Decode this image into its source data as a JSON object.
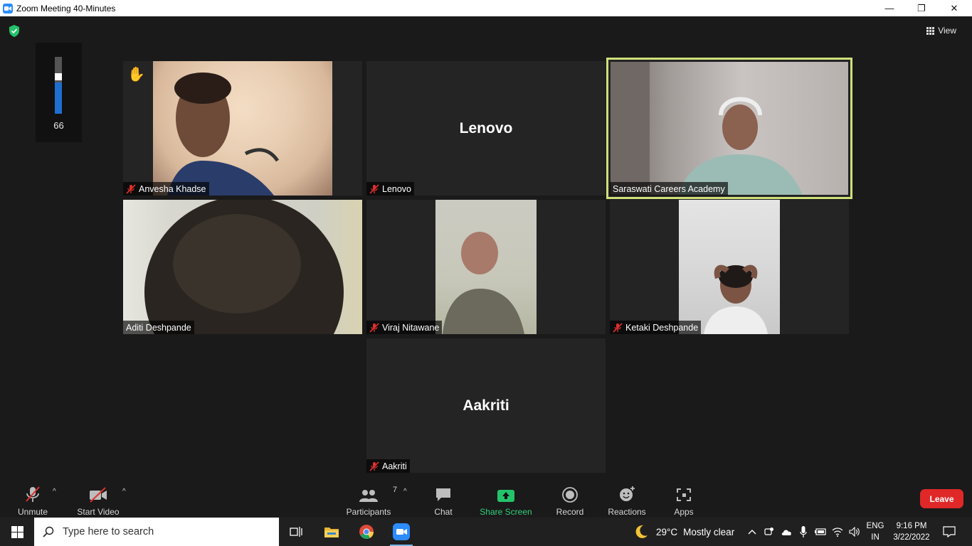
{
  "window": {
    "title": "Zoom Meeting 40-Minutes",
    "minimize": "—",
    "maximize": "❐",
    "close": "✕"
  },
  "meeting": {
    "view_label": "View",
    "audio_level": "66",
    "audio_level_fraction": 0.55
  },
  "tiles": [
    {
      "name": "Anvesha Khadse",
      "muted": true,
      "raised_hand": true
    },
    {
      "name": "Lenovo",
      "display_name": "Lenovo",
      "muted": true
    },
    {
      "name": "Saraswati Careers Academy",
      "muted": false,
      "active_speaker": true
    },
    {
      "name": "Aditi Deshpande",
      "muted": false
    },
    {
      "name": "Viraj Nitawane",
      "muted": true
    },
    {
      "name": "Ketaki Deshpande",
      "muted": true
    },
    {
      "name": "Aakriti",
      "display_name": "Aakriti",
      "muted": true
    }
  ],
  "toolbar": {
    "unmute": "Unmute",
    "start_video": "Start Video",
    "participants": "Participants",
    "participants_count": "7",
    "chat": "Chat",
    "share_screen": "Share Screen",
    "record": "Record",
    "reactions": "Reactions",
    "apps": "Apps",
    "leave": "Leave"
  },
  "taskbar": {
    "search_placeholder": "Type here to search",
    "weather_temp": "29°C",
    "weather_text": "Mostly clear",
    "lang_top": "ENG",
    "lang_bottom": "IN",
    "time": "9:16 PM",
    "date": "3/22/2022"
  },
  "colors": {
    "zoom_blue": "#2d8cff",
    "active_border": "#cfe07a",
    "leave_red": "#e02828",
    "share_green": "#31d07a",
    "muted_red": "#e0302c"
  }
}
